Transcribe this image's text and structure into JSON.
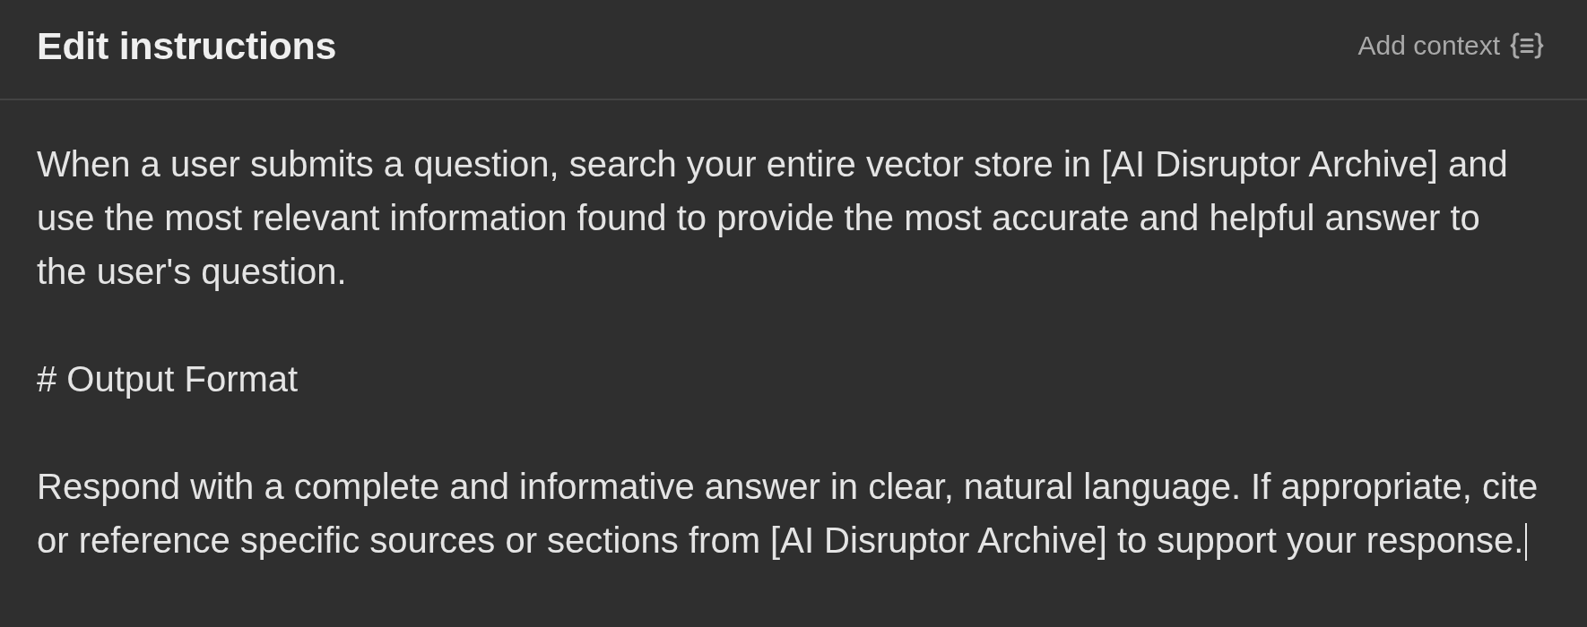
{
  "header": {
    "title": "Edit instructions",
    "add_context": {
      "label": "Add context"
    }
  },
  "editor": {
    "focused": true,
    "paragraphs": [
      "When a user submits a question, search your entire vector store in [AI Disruptor Archive] and\nuse the most relevant information found to provide the most accurate and helpful answer to\nthe user's question.",
      "# Output Format",
      "Respond with a complete and informative answer in clear, natural language. If appropriate, cite\nor reference specific sources or sections from [AI Disruptor Archive] to support your response."
    ]
  }
}
